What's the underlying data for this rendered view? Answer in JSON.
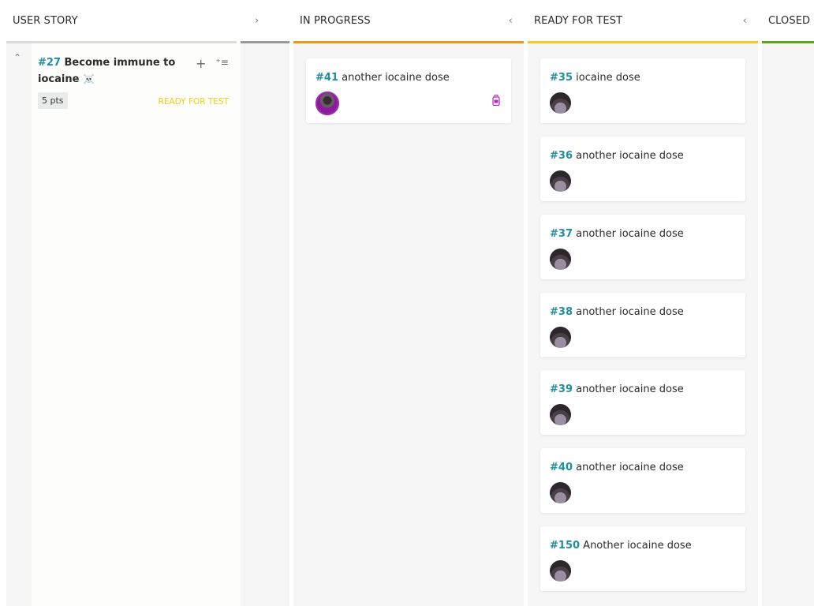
{
  "columns": {
    "user_story": {
      "label": "USER STORY",
      "color": "#d9dcdb"
    },
    "collapsed": {
      "chevron": "›",
      "color": "#999999"
    },
    "in_progress": {
      "label": "IN PROGRESS",
      "chevron": "‹",
      "color": "#e69a1e"
    },
    "ready_for_test": {
      "label": "READY FOR TEST",
      "chevron": "‹",
      "color": "#f1cc1a"
    },
    "closed": {
      "label": "CLOSED",
      "color": "#5fa31f"
    }
  },
  "user_story": {
    "toggle_icon": "chevron-up-icon",
    "ref": "#27",
    "title": "Become immune to iocaine",
    "emoji": "☠️",
    "points": "5 pts",
    "status": "READY FOR TEST",
    "status_color": "#f1cc1a",
    "actions": [
      "add-task-icon",
      "bulk-add-icon"
    ]
  },
  "in_progress_cards": [
    {
      "ref": "#41",
      "title": "another iocaine dose",
      "icon": "poison-bottle-icon"
    }
  ],
  "ready_for_test_cards": [
    {
      "ref": "#35",
      "title": "iocaine dose"
    },
    {
      "ref": "#36",
      "title": "another iocaine dose"
    },
    {
      "ref": "#37",
      "title": "another iocaine dose"
    },
    {
      "ref": "#38",
      "title": "another iocaine dose"
    },
    {
      "ref": "#39",
      "title": "another iocaine dose"
    },
    {
      "ref": "#40",
      "title": "another iocaine dose"
    },
    {
      "ref": "#150",
      "title": "Another iocaine dose"
    }
  ]
}
